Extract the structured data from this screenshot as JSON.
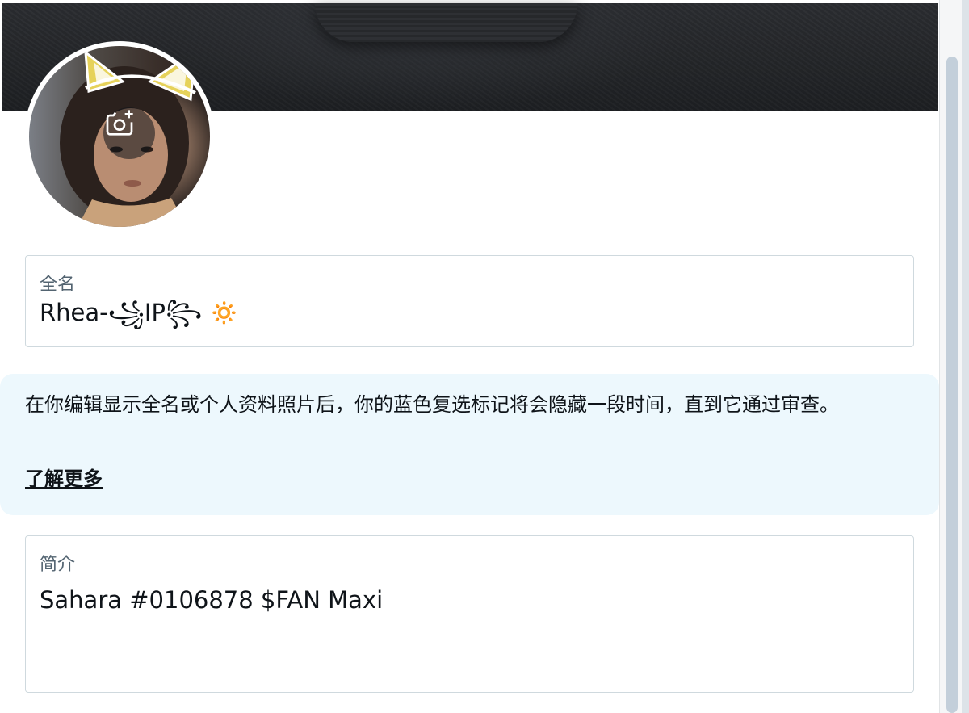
{
  "header": {
    "banner_alt": "header-image"
  },
  "avatar": {
    "edit_icon": "camera-plus-icon"
  },
  "name_field": {
    "label": "全名",
    "value": "Rhea-꧁IP꧂ 🔅"
  },
  "notice": {
    "text": "在你编辑显示全名或个人资料照片后，你的蓝色复选标记将会隐藏一段时间，直到它通过审查。",
    "link_label": "了解更多"
  },
  "bio_field": {
    "label": "简介",
    "value": "Sahara #0106878 $FAN Maxi"
  },
  "colors": {
    "notice_bg": "#edf8fd",
    "border": "#cfd9de",
    "label": "#536471",
    "text": "#0f1419"
  }
}
